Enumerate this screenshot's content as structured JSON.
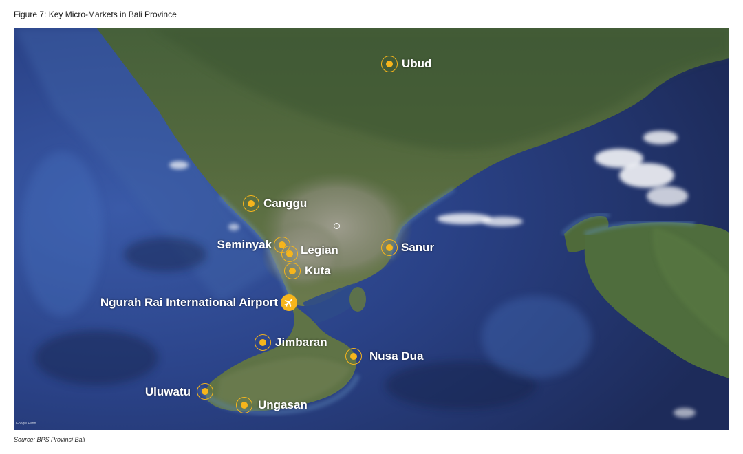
{
  "figure": {
    "title": "Figure 7: Key Micro-Markets in Bali Province",
    "source": "Source: BPS Provinsi Bali",
    "credit": "Google Earth"
  },
  "colors": {
    "marker": "#f6b51c",
    "ocean": "#273a70",
    "land": "#4a6034",
    "urban": "#8d8e7f",
    "label": "#ffffff"
  },
  "markets": [
    {
      "key": "ubud",
      "label": "Ubud"
    },
    {
      "key": "canggu",
      "label": "Canggu"
    },
    {
      "key": "seminyak",
      "label": "Seminyak"
    },
    {
      "key": "legian",
      "label": "Legian"
    },
    {
      "key": "kuta",
      "label": "Kuta"
    },
    {
      "key": "sanur",
      "label": "Sanur"
    },
    {
      "key": "jimbaran",
      "label": "Jimbaran"
    },
    {
      "key": "nusa-dua",
      "label": "Nusa Dua"
    },
    {
      "key": "uluwatu",
      "label": "Uluwatu"
    },
    {
      "key": "ungasan",
      "label": "Ungasan"
    }
  ],
  "airport": {
    "label": "Ngurah Rai International Airport",
    "icon": "airplane-icon"
  }
}
